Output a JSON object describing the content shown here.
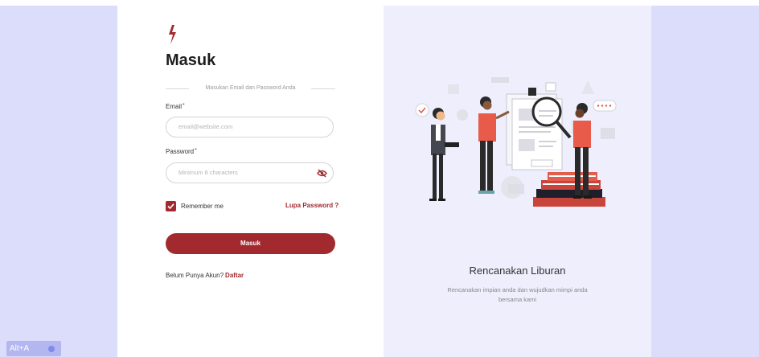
{
  "login": {
    "title": "Masuk",
    "divider_text": "Masukan Email dan Password Anda",
    "email_label": "Email",
    "email_placeholder": "email@website.com",
    "required_mark": "*",
    "password_label": "Password",
    "password_placeholder": "Minimum 8 characters",
    "remember_label": "Remember me",
    "forgot_link": "Lupa Password ?",
    "submit_label": "Masuk",
    "signup_text": "Belum Punya Akun?",
    "signup_link": "Daftar"
  },
  "illustration": {
    "title": "Rencanakan Liburan",
    "subtitle": "Rencanakan impian anda dan wujudkan mimpi anda bersama kami"
  },
  "overlay": {
    "shortcut_label": "Alt+A"
  },
  "colors": {
    "accent": "#a22a2f",
    "page_background": "#dcdcfb",
    "illustration_background": "#eeeefc"
  },
  "icons": {
    "logo": "lightning-bolt-icon",
    "password_toggle": "eye-slash-icon",
    "checkbox": "checkmark-icon"
  }
}
